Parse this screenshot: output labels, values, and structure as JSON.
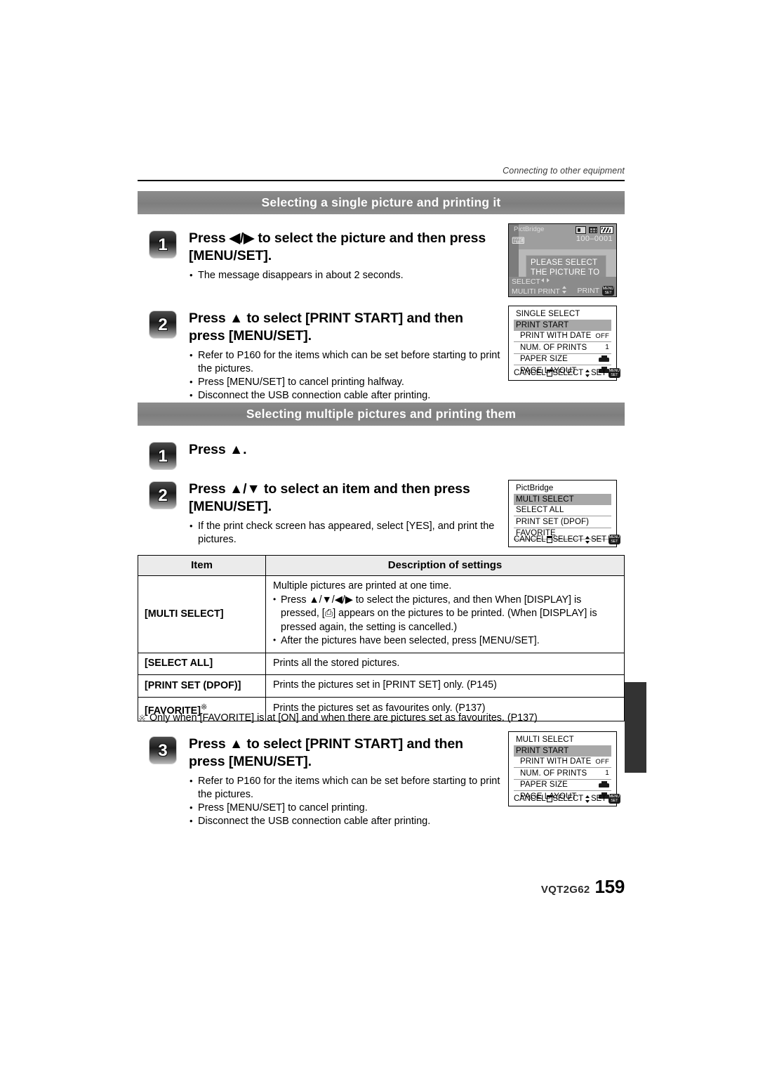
{
  "header": {
    "running_head": "Connecting to other equipment"
  },
  "sections": [
    {
      "title": "Selecting a single picture and printing it"
    },
    {
      "title": "Selecting multiple pictures and printing them"
    }
  ],
  "steps": {
    "s1_1": {
      "num": "1",
      "title": "Press ◀/▶ to select the picture and then press [MENU/SET].",
      "bullets": [
        "The message disappears in about 2 seconds."
      ]
    },
    "s1_2": {
      "num": "2",
      "title": "Press ▲ to select [PRINT START] and then press [MENU/SET].",
      "bullets": [
        "Refer to P160 for the items which can be set before starting to print the pictures.",
        "Press [MENU/SET] to cancel printing halfway.",
        "Disconnect the USB connection cable after printing."
      ]
    },
    "s2_1": {
      "num": "1",
      "title": "Press ▲."
    },
    "s2_2": {
      "num": "2",
      "title": "Press ▲/▼ to select an item and then press [MENU/SET].",
      "bullets": [
        "If the print check screen has appeared, select [YES], and print the pictures."
      ]
    },
    "s2_3": {
      "num": "3",
      "title": "Press ▲ to select [PRINT START] and then press [MENU/SET].",
      "bullets": [
        "Refer to P160 for the items which can be set before starting to print the pictures.",
        "Press [MENU/SET] to cancel printing.",
        "Disconnect the USB connection cable after printing."
      ]
    }
  },
  "table": {
    "headers": [
      "Item",
      "Description of settings"
    ],
    "rows": [
      {
        "item": "[MULTI SELECT]",
        "desc_lead": "Multiple pictures are printed at one time.",
        "desc_bullets": [
          "Press ▲/▼/◀/▶ to select the pictures, and then When [DISPLAY] is pressed, [⎙] appears on the pictures to be printed. (When [DISPLAY] is pressed again, the setting is cancelled.)",
          "After the pictures have been selected, press [MENU/SET]."
        ]
      },
      {
        "item": "[SELECT ALL]",
        "desc": "Prints all the stored pictures."
      },
      {
        "item": "[PRINT SET (DPOF)]",
        "desc": "Prints the pictures set in [PRINT SET] only. (P145)"
      },
      {
        "item": "[FAVORITE]",
        "item_marker": "※",
        "desc": "Prints the pictures set as favourites only. (P137)"
      }
    ],
    "footnote": {
      "marker": "※",
      "text": "Only when [FAVORITE] is at [ON] and when there are pictures set as favourites. (P137)"
    }
  },
  "lcd_screens": {
    "pictbridge_photo": {
      "label": "PictBridge",
      "frame_no": "100–0001",
      "message_line1": "PLEASE SELECT",
      "message_line2": "THE PICTURE TO PRINT",
      "bottom_left_1": "SELECT",
      "bottom_left_2": "MULITI PRINT",
      "bottom_right": "PRINT",
      "icons": [
        "picture-size-icon",
        "quality-grid-icon",
        "battery-icon",
        "printer-icon"
      ]
    },
    "single_select_menu": {
      "title": "SINGLE SELECT",
      "highlight": "PRINT START",
      "rows": [
        {
          "label": "PRINT WITH DATE",
          "value": "OFF",
          "value_type": "text"
        },
        {
          "label": "NUM. OF PRINTS",
          "value": "1",
          "value_type": "num"
        },
        {
          "label": "PAPER SIZE",
          "value": "",
          "value_type": "printer-icon"
        },
        {
          "label": "PAGE LAYOUT",
          "value": "",
          "value_type": "printer-icon"
        }
      ],
      "footer": {
        "cancel": "CANCEL",
        "select": "SELECT",
        "set": "SET",
        "set_badge_top": "MENU",
        "set_badge_bottom": "SET"
      }
    },
    "pictbridge_menu": {
      "title": "PictBridge",
      "highlight": "MULTI SELECT",
      "rows": [
        {
          "label": "SELECT ALL"
        },
        {
          "label": "PRINT SET (DPOF)"
        },
        {
          "label": "FAVORITE"
        }
      ],
      "footer": {
        "cancel": "CANCEL",
        "select": "SELECT",
        "set": "SET",
        "set_badge_top": "MENU",
        "set_badge_bottom": "SET"
      }
    },
    "multi_select_menu": {
      "title": "MULTI SELECT",
      "highlight": "PRINT START",
      "rows": [
        {
          "label": "PRINT WITH DATE",
          "value": "OFF",
          "value_type": "text"
        },
        {
          "label": "NUM. OF PRINTS",
          "value": "1",
          "value_type": "num"
        },
        {
          "label": "PAPER SIZE",
          "value": "",
          "value_type": "printer-icon"
        },
        {
          "label": "PAGE LAYOUT",
          "value": "",
          "value_type": "printer-icon"
        }
      ],
      "footer": {
        "cancel": "CANCEL",
        "select": "SELECT",
        "set": "SET",
        "set_badge_top": "MENU",
        "set_badge_bottom": "SET"
      }
    }
  },
  "footer": {
    "doc_code": "VQT2G62",
    "page_number": "159"
  },
  "colors": {
    "section_bar": "#808080",
    "table_header_bg": "#ebebeb",
    "lcd_highlight": "#a8a8a8",
    "edge_tab": "#333333"
  }
}
